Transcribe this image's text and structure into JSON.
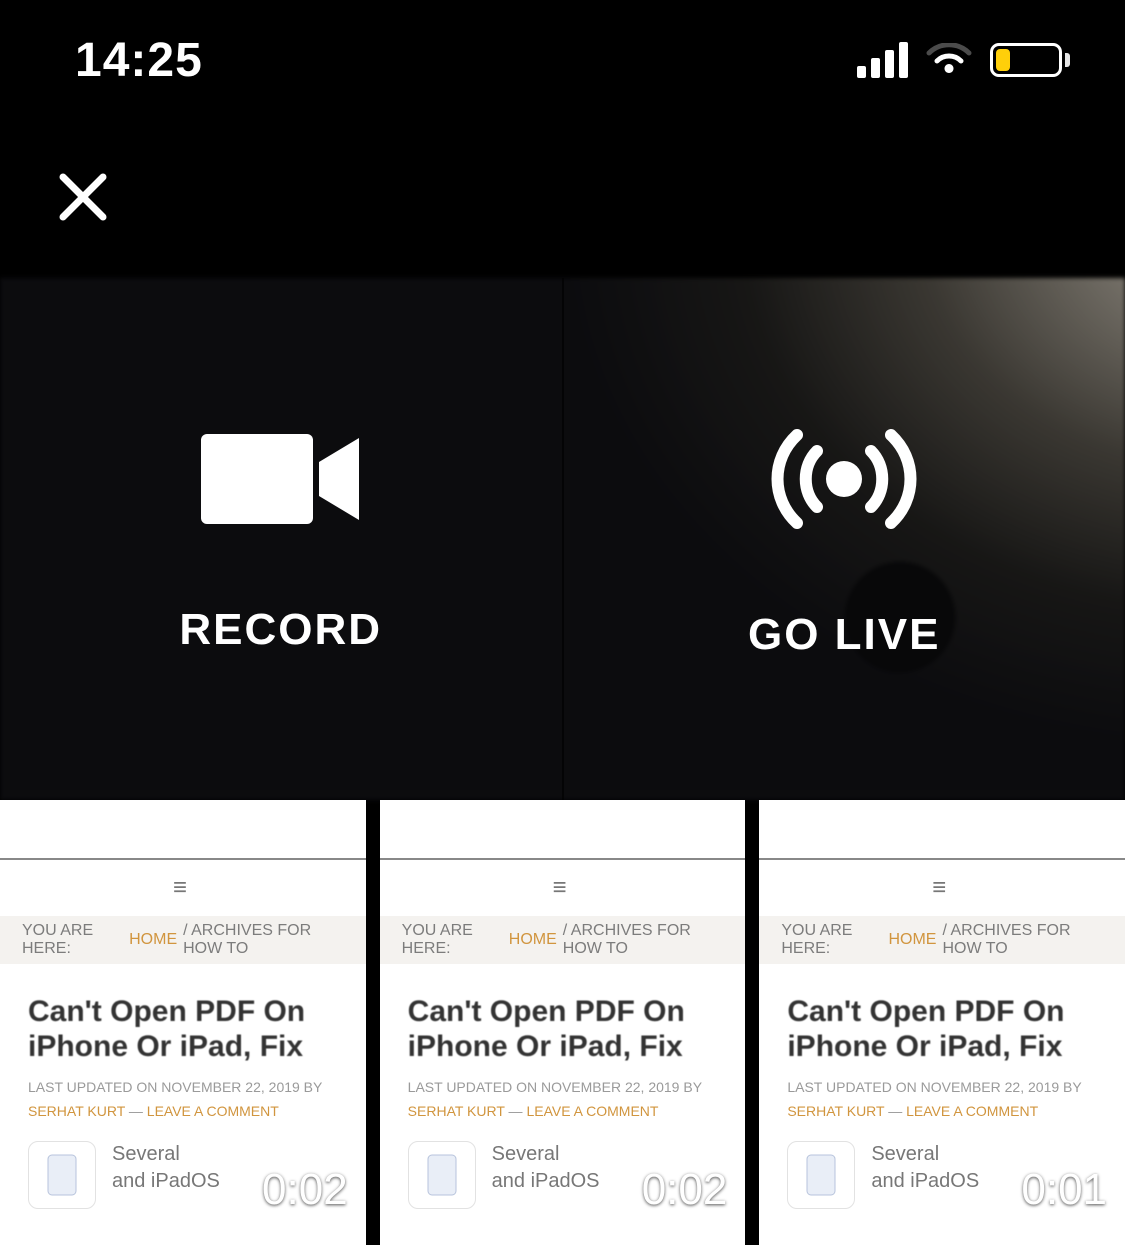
{
  "status": {
    "time": "14:25"
  },
  "actions": {
    "record_label": "RECORD",
    "go_live_label": "GO LIVE"
  },
  "thumb": {
    "breadcrumb_prefix": "YOU ARE HERE:",
    "breadcrumb_home": "HOME",
    "breadcrumb_suffix": "/ ARCHIVES FOR HOW TO",
    "title": "Can't Open PDF On iPhone Or iPad, Fix",
    "meta": "LAST UPDATED ON NOVEMBER 22, 2019 BY",
    "author": "SERHAT KURT",
    "dash": " — ",
    "leave_comment": "LEAVE A COMMENT",
    "preview_l1": "Several",
    "preview_l2": "and iPadOS"
  },
  "gallery": {
    "items": [
      {
        "duration": "0:02"
      },
      {
        "duration": "0:02"
      },
      {
        "duration": "0:01"
      }
    ]
  }
}
